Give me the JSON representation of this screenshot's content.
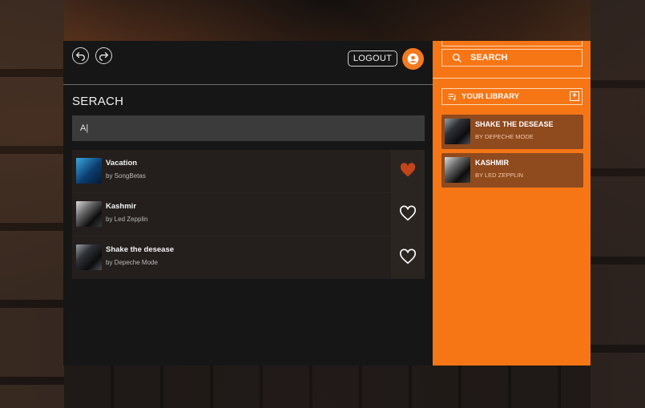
{
  "header": {
    "back_icon": "undo-arrow-icon",
    "forward_icon": "redo-arrow-icon",
    "logout_label": "LOGOUT",
    "avatar_icon": "user-circle-icon"
  },
  "search_page": {
    "title": "SERACH",
    "query_value": "A|",
    "results": [
      {
        "title": "Vacation",
        "artist": "by SongBetas",
        "liked": true
      },
      {
        "title": "Kashmir",
        "artist": "by Led Zepplin",
        "liked": false
      },
      {
        "title": "Shake the desease",
        "artist": "by Depeche Mode",
        "liked": false
      }
    ]
  },
  "sidebar": {
    "search_label": "SEARCH",
    "library_label": "YOUR LIBRARY",
    "library_add_icon": "plus-square-icon",
    "library_items": [
      {
        "title": "SHAKE THE DESEASE",
        "artist": "BY DEPECHE MODE"
      },
      {
        "title": "KASHMIR",
        "artist": "BY LED ZEPPLIN"
      }
    ]
  },
  "colors": {
    "accent": "#f67616",
    "liked_heart": "#c1441b",
    "panel": "#171616"
  }
}
